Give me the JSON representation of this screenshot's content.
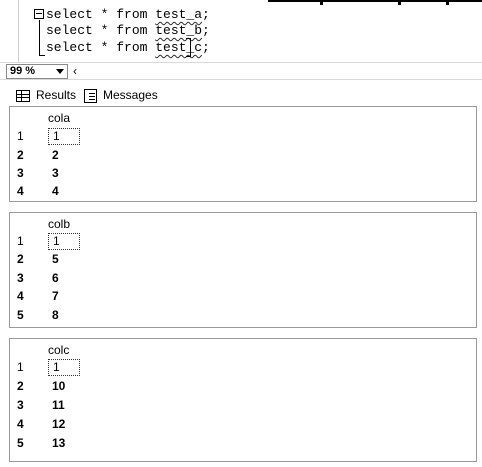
{
  "editor": {
    "lines": [
      {
        "keyword": "select * from ",
        "table": "test_a",
        "end": ";"
      },
      {
        "keyword": "select * from ",
        "table": "test_b",
        "end": ";"
      },
      {
        "keyword": "select * from ",
        "table": "test_c",
        "end": ";"
      }
    ]
  },
  "zoom": {
    "value": "99 %"
  },
  "tabs": {
    "results": "Results",
    "messages": "Messages"
  },
  "results": [
    {
      "column": "cola",
      "rows": [
        [
          "1",
          "1"
        ],
        [
          "2",
          "2"
        ],
        [
          "3",
          "3"
        ],
        [
          "4",
          "4"
        ]
      ]
    },
    {
      "column": "colb",
      "rows": [
        [
          "1",
          "1"
        ],
        [
          "2",
          "5"
        ],
        [
          "3",
          "6"
        ],
        [
          "4",
          "7"
        ],
        [
          "5",
          "8"
        ]
      ]
    },
    {
      "column": "colc",
      "rows": [
        [
          "1",
          "1"
        ],
        [
          "2",
          "10"
        ],
        [
          "3",
          "11"
        ],
        [
          "4",
          "12"
        ],
        [
          "5",
          "13"
        ]
      ]
    }
  ]
}
